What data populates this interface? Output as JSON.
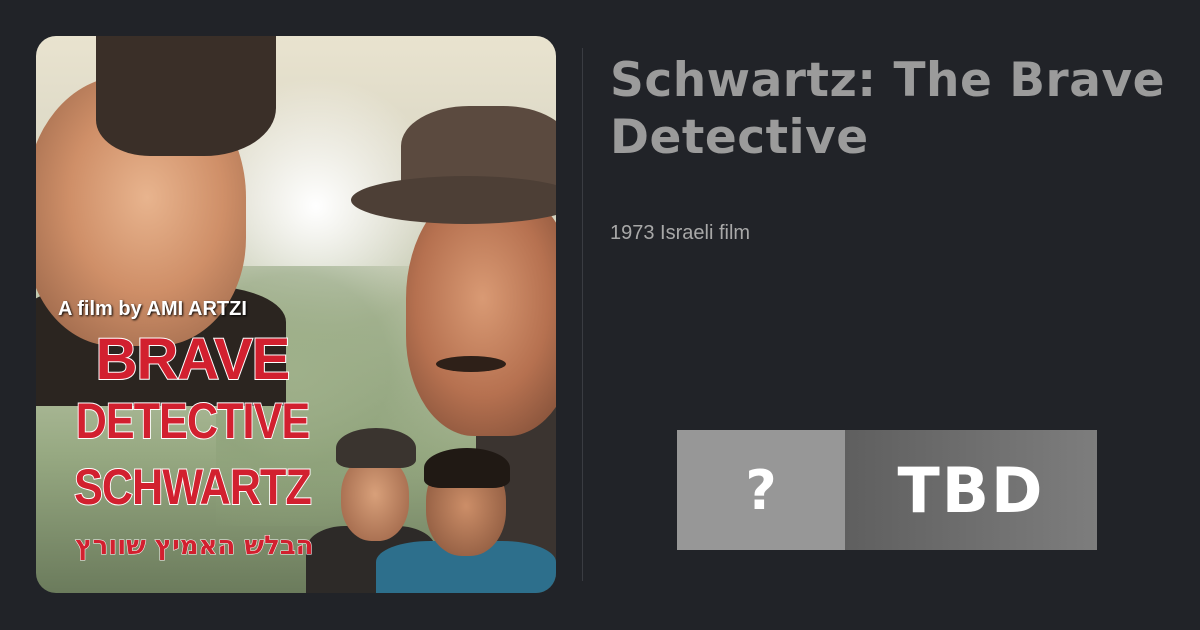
{
  "poster": {
    "credit": "A film by AMI ARTZI",
    "title_lines": [
      "BRAVE",
      "DETECTIVE",
      "SCHWARTZ"
    ],
    "hebrew_title": "הבלש האמיץ שוורץ"
  },
  "film": {
    "title_line1": "Schwartz: The Brave",
    "title_line2": "Detective",
    "description": "1973 Israeli film"
  },
  "score": {
    "symbol": "?",
    "label": "TBD"
  },
  "colors": {
    "background": "#212328",
    "title_text": "#9b9b9b",
    "poster_red": "#d2202f"
  }
}
